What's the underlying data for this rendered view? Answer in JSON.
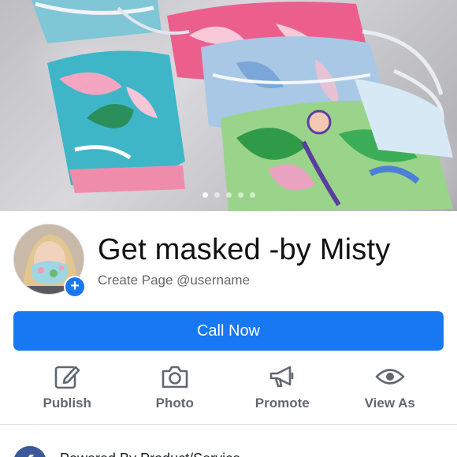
{
  "cover": {
    "slide_count": 5,
    "active_slide": 1
  },
  "profile": {
    "avatar_icon": "profile-photo",
    "add_icon": "+",
    "title": "Get masked -by Misty",
    "handle_line": "Create Page @username"
  },
  "cta": {
    "label": "Call Now"
  },
  "actions": [
    {
      "label": "Publish",
      "icon": "edit-icon"
    },
    {
      "label": "Photo",
      "icon": "camera-icon"
    },
    {
      "label": "Promote",
      "icon": "megaphone-icon"
    },
    {
      "label": "View As",
      "icon": "eye-icon"
    }
  ],
  "post_prompt": {
    "avatar_letter": "f",
    "text": "Powered By Product/Service"
  },
  "colors": {
    "accent": "#1877f2",
    "icon_gray": "#606770",
    "text_secondary": "#65676b"
  }
}
